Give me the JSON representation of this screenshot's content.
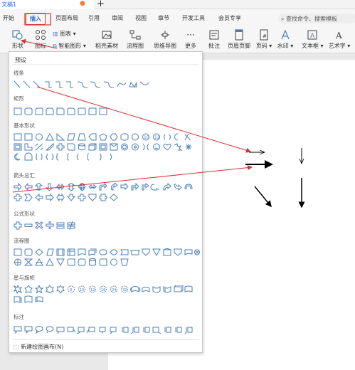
{
  "document": {
    "tab_title": "文稿1"
  },
  "menu": {
    "items": [
      "开始",
      "插入",
      "页面布局",
      "引用",
      "审阅",
      "视图",
      "章节",
      "开发工具",
      "会员专享"
    ],
    "active": "插入",
    "search_placeholder": "查找命令、搜索模板"
  },
  "ribbon": {
    "shape": "形状",
    "icon": "图标",
    "chart": "图表",
    "smart_graphic": "智能图形",
    "material": "稻壳素材",
    "flowchart": "流程图",
    "mindmap": "思维导图",
    "more": "更多",
    "comment": "批注",
    "header_footer": "页眉页脚",
    "page_number": "页码",
    "watermark": "水印",
    "textbox": "文本框",
    "art_text": "艺术字"
  },
  "shapes_panel": {
    "preset_label": "预设",
    "sections": [
      "线条",
      "矩形",
      "基本形状",
      "箭头总汇",
      "公式形状",
      "流程图",
      "星与旗帜",
      "标注"
    ],
    "new_canvas": "新建绘图画布(N)"
  },
  "colors": {
    "accent_blue": "#2a6fd6",
    "annotation_red": "#d93030",
    "shape_icon_blue": "#4a7fb8"
  }
}
